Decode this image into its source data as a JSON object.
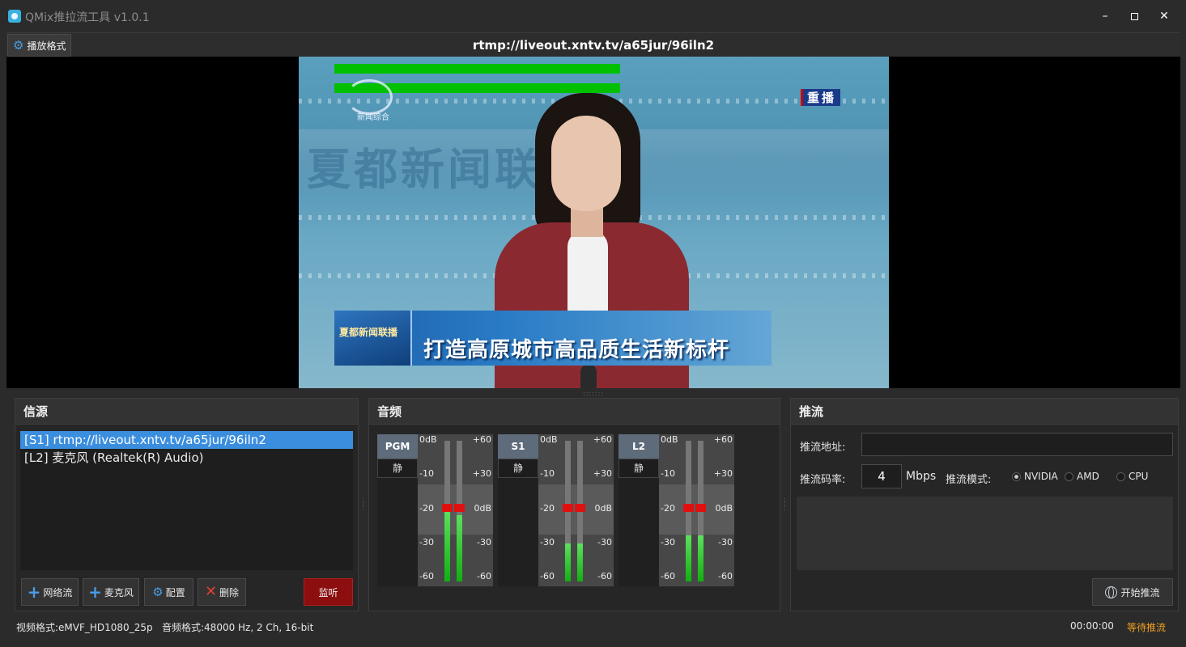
{
  "app": {
    "title": "QMix推拉流工具 v1.0.1",
    "window_controls": {
      "minimize": "–",
      "close": "✕"
    }
  },
  "preview": {
    "play_format_label": "播放格式",
    "stream_url": "rtmp://liveout.xntv.tv/a65jur/96iln2",
    "video": {
      "audio_levels": [
        0.82,
        0.82
      ],
      "channel_logo_text": "新闻综合",
      "replay_badge": "重播",
      "background_text": "夏都新闻联播",
      "banner_logo_text": "夏都新闻联播",
      "banner_text": "打造高原城市高品质生活新标杆"
    }
  },
  "sources": {
    "title": "信源",
    "items": [
      {
        "label": "[S1] rtmp://liveout.xntv.tv/a65jur/96iln2",
        "selected": true
      },
      {
        "label": "[L2] 麦克风 (Realtek(R) Audio)",
        "selected": false
      }
    ],
    "buttons": {
      "add_network": "网络流",
      "add_mic": "麦克风",
      "config": "配置",
      "delete": "删除",
      "monitor": "监听"
    }
  },
  "audio": {
    "title": "音频",
    "mute_label": "静",
    "scale_left": [
      "0dB",
      "-10",
      "-20",
      "-30",
      "-60"
    ],
    "scale_right": [
      "+60",
      "+30",
      "0dB",
      "-30",
      "-60"
    ],
    "strips": [
      {
        "label": "PGM",
        "levels": [
          0.5,
          0.47
        ],
        "peaks": [
          0.55,
          0.55
        ]
      },
      {
        "label": "S1",
        "levels": [
          0.27,
          0.27
        ],
        "peaks": [
          0.55,
          0.55
        ]
      },
      {
        "label": "L2",
        "levels": [
          0.33,
          0.33
        ],
        "peaks": [
          0.55,
          0.55
        ]
      }
    ]
  },
  "streaming": {
    "title": "推流",
    "url_label": "推流地址:",
    "url_value": "",
    "bitrate_label": "推流码率:",
    "bitrate_value": "4",
    "bitrate_unit": "Mbps",
    "mode_label": "推流模式:",
    "modes": [
      {
        "label": "NVIDIA",
        "checked": true
      },
      {
        "label": "AMD",
        "checked": false
      },
      {
        "label": "CPU",
        "checked": false
      }
    ],
    "start_label": "开始推流"
  },
  "status": {
    "video_format": "视频格式:eMVF_HD1080_25p",
    "audio_format": "音频格式:48000 Hz, 2 Ch, 16-bit",
    "time": "00:00:00",
    "state": "等待推流",
    "state_color": "#f0a020"
  },
  "colors": {
    "accent": "#3b8ede",
    "monitor_button": "#8c0e0e",
    "meter_green": "#10b010",
    "meter_peak": "#e01010",
    "video_level": "#00c000"
  }
}
